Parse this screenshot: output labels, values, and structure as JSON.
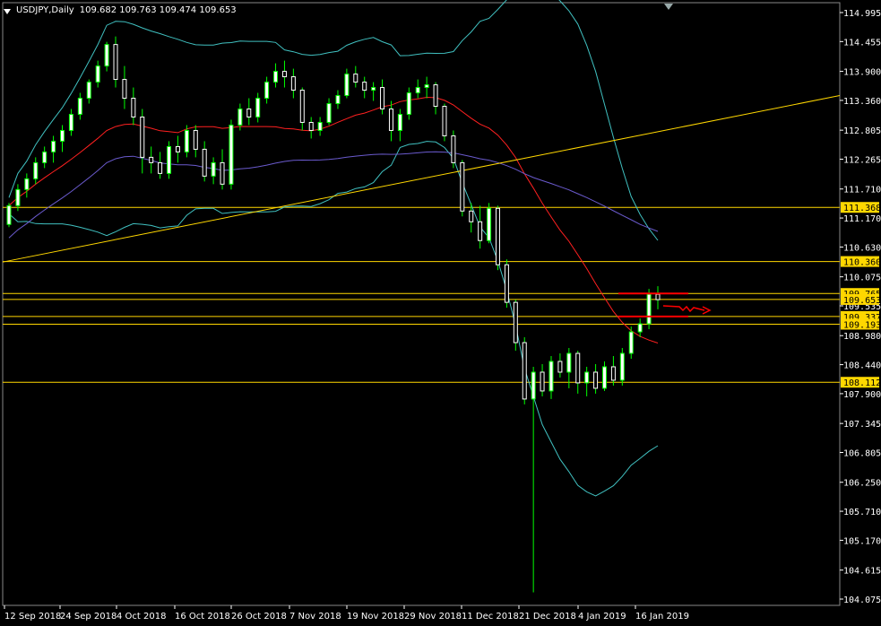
{
  "header": {
    "symbol": "USDJPY,Daily",
    "ohlc": "109.682 109.763 109.474 109.653"
  },
  "colors": {
    "background": "#000000",
    "axis": "#ffffff",
    "bull": "#ffffff",
    "bear": "#ffffff",
    "wick": "#00ff00",
    "bollinger_outer": "#40c0c0",
    "bollinger_mid": "#ff2020",
    "ma200": "#6a5acd",
    "trendline": "#ffd700",
    "hline": "#ffd700",
    "zone": "#ff0000"
  },
  "chart_data": {
    "type": "candlestick",
    "yaxis_ticks": [
      "114.995",
      "114.455",
      "113.900",
      "113.360",
      "112.805",
      "112.265",
      "111.710",
      "111.170",
      "110.630",
      "110.075",
      "109.535",
      "108.980",
      "108.440",
      "107.900",
      "107.345",
      "106.805",
      "106.250",
      "105.710",
      "105.170",
      "104.615",
      "104.075"
    ],
    "ylim": [
      104.075,
      114.995
    ],
    "xaxis_ticks": [
      "12 Sep 2018",
      "24 Sep 2018",
      "4 Oct 2018",
      "16 Oct 2018",
      "26 Oct 2018",
      "7 Nov 2018",
      "19 Nov 2018",
      "29 Nov 2018",
      "11 Dec 2018",
      "21 Dec 2018",
      "4 Jan 2019",
      "16 Jan 2019"
    ],
    "level_labels": [
      {
        "label": "111.368",
        "value": 111.368
      },
      {
        "label": "110.360",
        "value": 110.36
      },
      {
        "label": "109.765",
        "value": 109.765
      },
      {
        "label": "109.653",
        "value": 109.653
      },
      {
        "label": "109.337",
        "value": 109.337
      },
      {
        "label": "109.193",
        "value": 109.193
      },
      {
        "label": "108.112",
        "value": 108.112
      }
    ],
    "candles": [
      [
        111.05,
        111.45,
        111.0,
        111.4
      ],
      [
        111.4,
        111.8,
        111.3,
        111.7
      ],
      [
        111.7,
        112.0,
        111.55,
        111.9
      ],
      [
        111.9,
        112.3,
        111.8,
        112.2
      ],
      [
        112.2,
        112.5,
        112.1,
        112.4
      ],
      [
        112.4,
        112.7,
        112.2,
        112.6
      ],
      [
        112.6,
        112.9,
        112.4,
        112.8
      ],
      [
        112.8,
        113.2,
        112.7,
        113.1
      ],
      [
        113.1,
        113.5,
        113.0,
        113.4
      ],
      [
        113.4,
        113.75,
        113.3,
        113.7
      ],
      [
        113.7,
        114.1,
        113.6,
        114.0
      ],
      [
        114.0,
        114.45,
        113.9,
        114.4
      ],
      [
        114.4,
        114.55,
        113.6,
        113.75
      ],
      [
        113.75,
        114.0,
        113.2,
        113.4
      ],
      [
        113.4,
        113.6,
        112.9,
        113.05
      ],
      [
        113.05,
        113.2,
        112.0,
        112.3
      ],
      [
        112.3,
        112.5,
        112.0,
        112.2
      ],
      [
        112.2,
        112.4,
        111.9,
        112.0
      ],
      [
        112.0,
        112.6,
        111.9,
        112.5
      ],
      [
        112.5,
        112.7,
        112.2,
        112.4
      ],
      [
        112.4,
        112.9,
        112.3,
        112.8
      ],
      [
        112.8,
        112.9,
        112.3,
        112.45
      ],
      [
        112.45,
        112.6,
        111.85,
        111.95
      ],
      [
        111.95,
        112.3,
        111.8,
        112.2
      ],
      [
        112.2,
        112.45,
        111.7,
        111.8
      ],
      [
        111.8,
        113.0,
        111.7,
        112.9
      ],
      [
        112.9,
        113.3,
        112.8,
        113.2
      ],
      [
        113.2,
        113.4,
        112.9,
        113.05
      ],
      [
        113.05,
        113.5,
        112.95,
        113.4
      ],
      [
        113.4,
        113.8,
        113.3,
        113.7
      ],
      [
        113.7,
        114.05,
        113.6,
        113.9
      ],
      [
        113.9,
        114.1,
        113.6,
        113.8
      ],
      [
        113.8,
        113.95,
        113.4,
        113.55
      ],
      [
        113.55,
        113.6,
        112.8,
        112.95
      ],
      [
        112.95,
        113.05,
        112.65,
        112.8
      ],
      [
        112.8,
        113.05,
        112.7,
        112.95
      ],
      [
        112.95,
        113.4,
        112.9,
        113.3
      ],
      [
        113.3,
        113.55,
        113.2,
        113.45
      ],
      [
        113.45,
        113.95,
        113.4,
        113.85
      ],
      [
        113.85,
        114.0,
        113.6,
        113.7
      ],
      [
        113.7,
        113.8,
        113.4,
        113.55
      ],
      [
        113.55,
        113.7,
        113.35,
        113.6
      ],
      [
        113.6,
        113.75,
        113.1,
        113.2
      ],
      [
        113.2,
        113.35,
        112.6,
        112.8
      ],
      [
        112.8,
        113.2,
        112.6,
        113.1
      ],
      [
        113.1,
        113.6,
        113.0,
        113.5
      ],
      [
        113.5,
        113.75,
        113.4,
        113.6
      ],
      [
        113.6,
        113.8,
        113.4,
        113.65
      ],
      [
        113.65,
        113.7,
        113.1,
        113.25
      ],
      [
        113.25,
        113.3,
        112.6,
        112.7
      ],
      [
        112.7,
        112.8,
        112.1,
        112.2
      ],
      [
        112.2,
        112.25,
        111.2,
        111.3
      ],
      [
        111.3,
        111.45,
        110.9,
        111.1
      ],
      [
        111.1,
        111.4,
        110.6,
        110.75
      ],
      [
        110.75,
        111.45,
        110.7,
        111.35
      ],
      [
        111.35,
        111.4,
        110.2,
        110.3
      ],
      [
        110.3,
        110.4,
        109.5,
        109.6
      ],
      [
        109.6,
        109.65,
        108.7,
        108.85
      ],
      [
        108.85,
        108.95,
        107.7,
        107.8
      ],
      [
        107.8,
        108.4,
        104.2,
        108.3
      ],
      [
        108.3,
        108.45,
        107.85,
        107.95
      ],
      [
        107.95,
        108.6,
        107.8,
        108.5
      ],
      [
        108.5,
        108.65,
        108.2,
        108.3
      ],
      [
        108.3,
        108.75,
        108.0,
        108.65
      ],
      [
        108.65,
        108.7,
        107.9,
        108.1
      ],
      [
        108.1,
        108.4,
        107.85,
        108.3
      ],
      [
        108.3,
        108.45,
        107.9,
        108.0
      ],
      [
        108.0,
        108.5,
        107.95,
        108.4
      ],
      [
        108.4,
        108.6,
        108.05,
        108.15
      ],
      [
        108.15,
        108.75,
        108.05,
        108.65
      ],
      [
        108.65,
        109.15,
        108.55,
        109.05
      ],
      [
        109.05,
        109.3,
        108.95,
        109.2
      ],
      [
        109.2,
        109.85,
        109.1,
        109.75
      ],
      [
        109.75,
        109.9,
        109.47,
        109.65
      ]
    ]
  }
}
